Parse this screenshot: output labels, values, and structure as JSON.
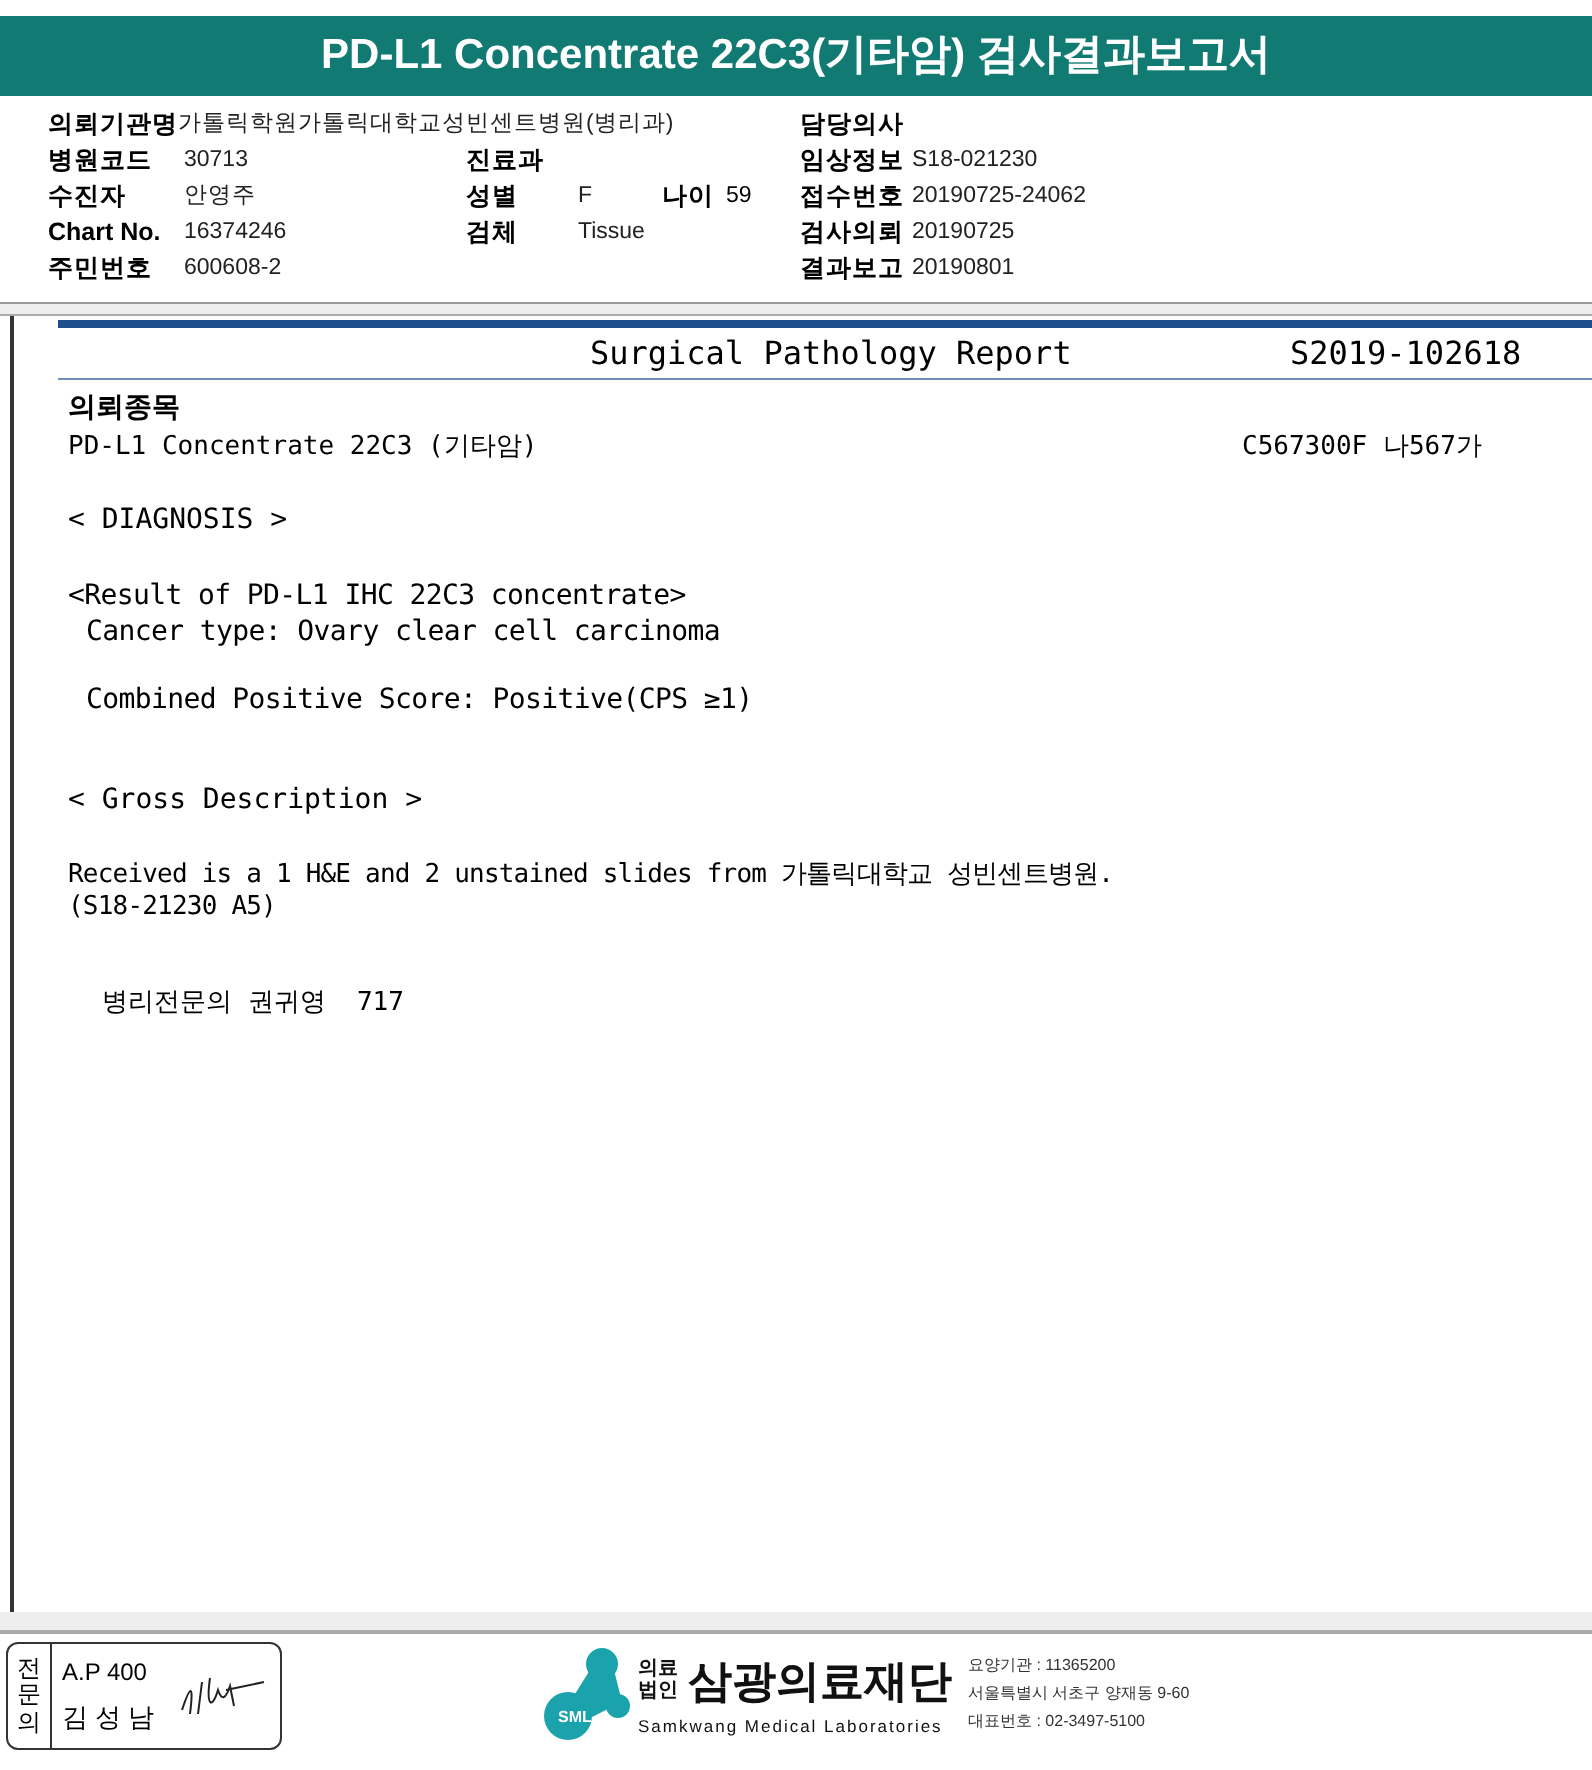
{
  "title": "PD-L1 Concentrate 22C3(기타암) 검사결과보고서",
  "info_rows": [
    {
      "left": {
        "label": "의뢰기관명",
        "value": "가톨릭학원가톨릭대학교성빈센트병원(병리과)"
      },
      "right": {
        "label": "담당의사"
      }
    },
    {
      "left": {
        "label": "병원코드",
        "value": "30713"
      },
      "middle": {
        "label": "진료과"
      },
      "right": {
        "label": "임상정보",
        "value": "S18-021230"
      }
    },
    {
      "left": {
        "label": "수진자",
        "value": "안영주"
      },
      "middle": {
        "label": "성별",
        "value": "F",
        "extra_label": "나이",
        "extra_value": "59"
      },
      "right": {
        "label": "접수번호",
        "value": "20190725-24062"
      }
    },
    {
      "left": {
        "label": "Chart No.",
        "value": "16374246"
      },
      "middle": {
        "label": "검체",
        "value": "Tissue"
      },
      "right": {
        "label": "검사의뢰",
        "value": "20190725"
      }
    },
    {
      "left": {
        "label": "주민번호",
        "value": "600608-2"
      },
      "right": {
        "label": "결과보고",
        "value": "20190801"
      }
    }
  ],
  "report": {
    "title": "Surgical Pathology Report",
    "number": "S2019-102618",
    "item_heading": "의뢰종목",
    "item_name": "PD-L1 Concentrate 22C3 (기타암)",
    "item_code": "C567300F 나567가",
    "lines": [
      {
        "kind": "heading",
        "text": "< DIAGNOSIS >"
      },
      {
        "kind": "gap"
      },
      {
        "kind": "text",
        "text": "<Result of PD-L1 IHC 22C3 concentrate>"
      },
      {
        "kind": "indent",
        "text": "Cancer type: Ovary clear cell carcinoma"
      },
      {
        "kind": "gap"
      },
      {
        "kind": "indent",
        "text": "Combined Positive Score: Positive(CPS ≥1)"
      },
      {
        "kind": "gap"
      },
      {
        "kind": "gap"
      },
      {
        "kind": "heading",
        "text": "< Gross Description >"
      },
      {
        "kind": "gap"
      },
      {
        "kind": "small",
        "text": "Received is a 1 H&E and 2 unstained slides from 가톨릭대학교 성빈센트병원."
      },
      {
        "kind": "small",
        "text": "(S18-21230 A5)"
      },
      {
        "kind": "gap"
      },
      {
        "kind": "gap"
      },
      {
        "kind": "sign",
        "text": "병리전문의 권귀영  717"
      }
    ]
  },
  "stamp": {
    "side": "전문의",
    "code": "A.P 400",
    "name": "김 성 남"
  },
  "footer": {
    "org_type": "의료법인",
    "org_name": "삼광의료재단",
    "org_en": "Samkwang Medical Laboratories",
    "logo_text": "SML",
    "contacts": [
      "요양기관 : 11365200",
      "서울특별시 서초구 양재동 9-60",
      "대표번호 : 02-3497-5100"
    ]
  }
}
